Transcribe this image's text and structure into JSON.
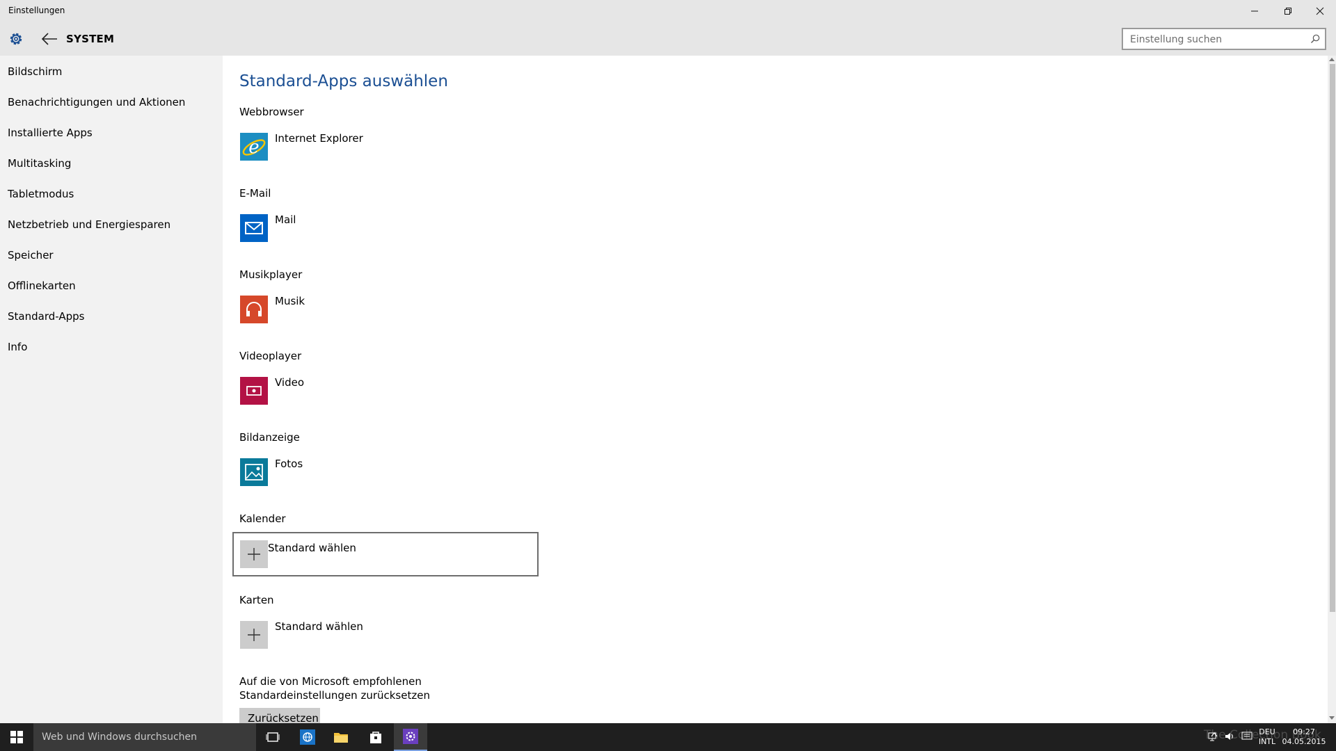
{
  "window": {
    "title": "Einstellungen"
  },
  "header": {
    "section": "SYSTEM",
    "search_placeholder": "Einstellung suchen"
  },
  "sidebar": {
    "items": [
      {
        "label": "Bildschirm"
      },
      {
        "label": "Benachrichtigungen und Aktionen"
      },
      {
        "label": "Installierte Apps"
      },
      {
        "label": "Multitasking"
      },
      {
        "label": "Tabletmodus"
      },
      {
        "label": "Netzbetrieb und Energiesparen"
      },
      {
        "label": "Speicher"
      },
      {
        "label": "Offlinekarten"
      },
      {
        "label": "Standard-Apps"
      },
      {
        "label": "Info"
      }
    ]
  },
  "main": {
    "title": "Standard-Apps auswählen",
    "categories": [
      {
        "label": "Webbrowser",
        "app": "Internet Explorer",
        "icon": "internet-explorer-icon",
        "color": "#1c8ec2"
      },
      {
        "label": "E-Mail",
        "app": "Mail",
        "icon": "mail-icon",
        "color": "#0063c5"
      },
      {
        "label": "Musikplayer",
        "app": "Musik",
        "icon": "headphones-icon",
        "color": "#d6482a"
      },
      {
        "label": "Videoplayer",
        "app": "Video",
        "icon": "video-icon",
        "color": "#b31245"
      },
      {
        "label": "Bildanzeige",
        "app": "Fotos",
        "icon": "photos-icon",
        "color": "#0a7a9a"
      },
      {
        "label": "Kalender",
        "app": "Standard wählen",
        "icon": "plus-icon",
        "color": "#cccccc"
      },
      {
        "label": "Karten",
        "app": "Standard wählen",
        "icon": "plus-icon",
        "color": "#cccccc"
      }
    ],
    "reset_text": "Auf die von Microsoft empfohlenen Standardeinstellungen zurücksetzen",
    "reset_button": "Zurücksetzen"
  },
  "taskbar": {
    "search_placeholder": "Web und Windows durchsuchen",
    "watermark": "The Collection Book",
    "language": "DEU",
    "keyboard": "INTL",
    "time": "09:27",
    "date": "04.05.2015"
  },
  "colors": {
    "accent": "#1b4f93",
    "sidebar_bg": "#f2f2f2",
    "titlebar_bg": "#e6e6e6",
    "taskbar_bg": "#1f1f1f"
  }
}
